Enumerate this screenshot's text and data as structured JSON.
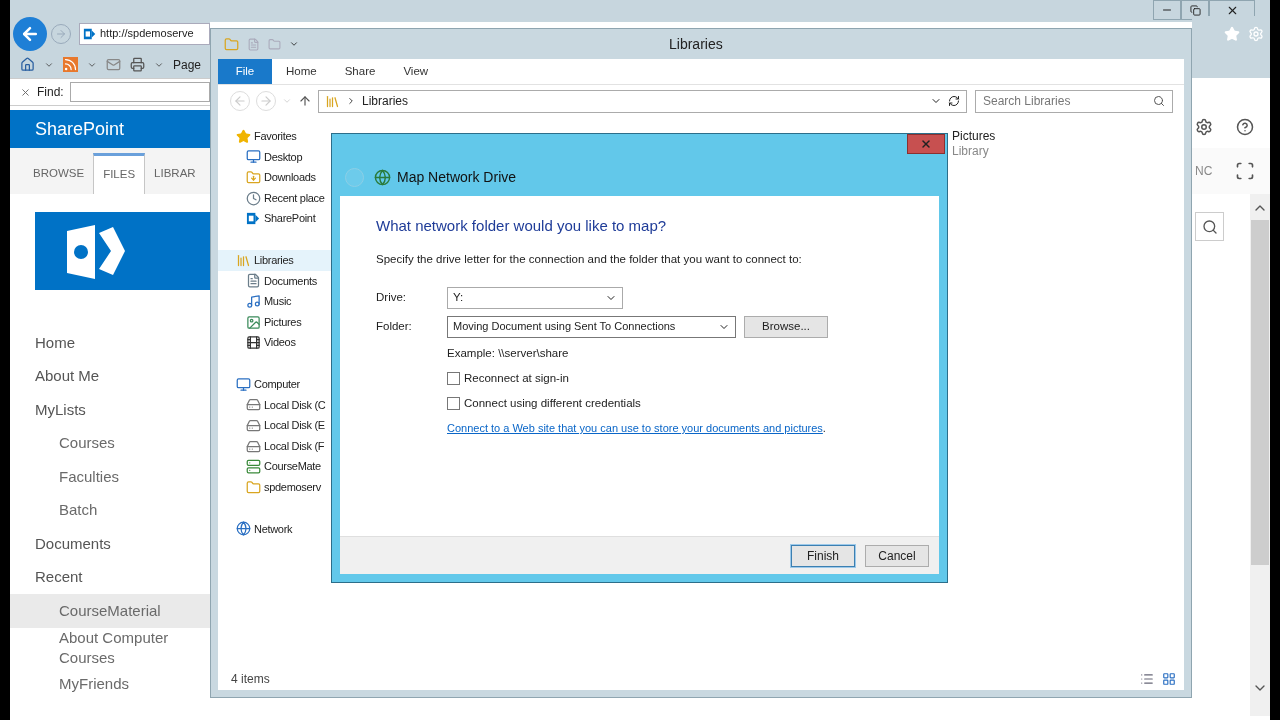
{
  "browser": {
    "address": "http://spdemoserve",
    "page_menu": "Page",
    "find_label": "Find:",
    "suite_title": "SharePoint",
    "ribbon_tabs": [
      {
        "label": "BROWSE",
        "selected": false
      },
      {
        "label": "FILES",
        "selected": true
      },
      {
        "label": "LIBRAR",
        "selected": false
      }
    ],
    "ribbon_right": "NC",
    "nav": [
      {
        "label": "Home",
        "selected": false
      },
      {
        "label": "About Me",
        "selected": false
      },
      {
        "label": "MyLists",
        "selected": false,
        "children": [
          {
            "label": "Courses",
            "selected": false
          },
          {
            "label": "Faculties",
            "selected": false
          },
          {
            "label": "Batch",
            "selected": false
          }
        ]
      },
      {
        "label": "Documents",
        "selected": false
      },
      {
        "label": "Recent",
        "selected": false,
        "children": [
          {
            "label": "CourseMaterial",
            "selected": true
          },
          {
            "label": "About Computer Courses",
            "selected": false
          },
          {
            "label": "MyFriends",
            "selected": false
          }
        ]
      }
    ]
  },
  "explorer": {
    "title": "Libraries",
    "ribbon_tabs": [
      {
        "label": "File",
        "selected": true
      },
      {
        "label": "Home",
        "selected": false
      },
      {
        "label": "Share",
        "selected": false
      },
      {
        "label": "View",
        "selected": false
      }
    ],
    "address": "Libraries",
    "search": {
      "placeholder": "Search Libraries"
    },
    "nav": [
      {
        "label": "Favorites",
        "kind": "star",
        "selected": false,
        "children": [
          {
            "label": "Desktop",
            "kind": "desktop",
            "selected": false
          },
          {
            "label": "Downloads",
            "kind": "downloads",
            "selected": false
          },
          {
            "label": "Recent place",
            "kind": "recent",
            "selected": false
          },
          {
            "label": "SharePoint",
            "kind": "site",
            "selected": false
          }
        ]
      },
      {
        "label": "Libraries",
        "kind": "library",
        "selected": true,
        "children": [
          {
            "label": "Documents",
            "kind": "documents",
            "selected": false
          },
          {
            "label": "Music",
            "kind": "music",
            "selected": false
          },
          {
            "label": "Pictures",
            "kind": "pictures",
            "selected": false
          },
          {
            "label": "Videos",
            "kind": "videos",
            "selected": false
          }
        ]
      },
      {
        "label": "Computer",
        "kind": "computer",
        "selected": false,
        "children": [
          {
            "label": "Local Disk (C",
            "kind": "drive",
            "selected": false
          },
          {
            "label": "Local Disk (E",
            "kind": "drive",
            "selected": false
          },
          {
            "label": "Local Disk (F",
            "kind": "drive",
            "selected": false
          },
          {
            "label": "CourseMate",
            "kind": "netdrive",
            "selected": false
          },
          {
            "label": "spdemoserv",
            "kind": "folder",
            "selected": false
          }
        ]
      },
      {
        "label": "Network",
        "kind": "network",
        "selected": false
      }
    ],
    "items": [
      {
        "name": "Pictures",
        "type": "Library"
      }
    ],
    "status": "4 items"
  },
  "dialog": {
    "title": "Map Network Drive",
    "heading": "What network folder would you like to map?",
    "instruction": "Specify the drive letter for the connection and the folder that you want to connect to:",
    "drive": {
      "label": "Drive:",
      "value": "Y:"
    },
    "folder": {
      "label": "Folder:",
      "value": "Moving Document using Sent To Connections"
    },
    "browse": "Browse...",
    "example": "Example: \\\\server\\share",
    "options": [
      {
        "label": "Reconnect at sign-in",
        "checked": false
      },
      {
        "label": "Connect using different credentials",
        "checked": false
      }
    ],
    "link": "Connect to a Web site that you can use to store your documents and pictures",
    "link_end": ".",
    "buttons": [
      {
        "label": "Finish",
        "default": true
      },
      {
        "label": "Cancel",
        "default": false
      }
    ]
  }
}
